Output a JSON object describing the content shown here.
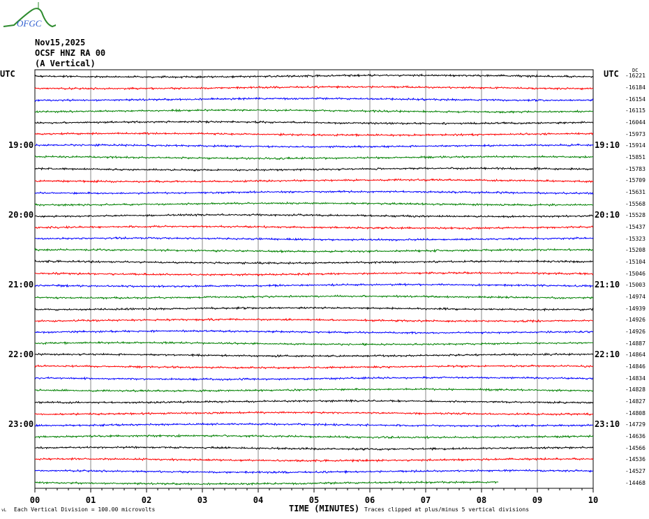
{
  "header": {
    "date": "Nov15,2025",
    "station": "OCSF HNZ RA 00",
    "component": "(A Vertical)",
    "logo_text": "OFGC"
  },
  "chart_data": {
    "type": "line",
    "title": "OCSF HNZ RA 00 (A Vertical) Nov15,2025",
    "xlabel": "TIME (MINUTES)",
    "x_ticks": [
      "00",
      "01",
      "02",
      "03",
      "04",
      "05",
      "06",
      "07",
      "08",
      "09",
      "10"
    ],
    "xlim": [
      0,
      10
    ],
    "left_axis_title": "UTC",
    "right_axis_title": "UTC",
    "dc_header": "DC",
    "left_time_labels": [
      {
        "row": 6,
        "label": "19:00"
      },
      {
        "row": 12,
        "label": "20:00"
      },
      {
        "row": 18,
        "label": "21:00"
      },
      {
        "row": 24,
        "label": "22:00"
      },
      {
        "row": 30,
        "label": "23:00"
      }
    ],
    "right_time_labels": [
      {
        "row": 6,
        "label": "19:10"
      },
      {
        "row": 12,
        "label": "20:10"
      },
      {
        "row": 18,
        "label": "21:10"
      },
      {
        "row": 24,
        "label": "22:10"
      },
      {
        "row": 30,
        "label": "23:10"
      }
    ],
    "trace_colors": [
      "#000000",
      "#ff0000",
      "#0000ff",
      "#008000"
    ],
    "dc_offsets": [
      "-16221",
      "-16184",
      "-16154",
      "-16115",
      "-16044",
      "-15973",
      "-15914",
      "-15851",
      "-15783",
      "-15709",
      "-15631",
      "-15568",
      "-15528",
      "-15437",
      "-15323",
      "-15208",
      "-15104",
      "-15046",
      "-15003",
      "-14974",
      "-14939",
      "-14926",
      "-14926",
      "-14887",
      "-14864",
      "-14846",
      "-14834",
      "-14828",
      "-14827",
      "-14808",
      "-14729",
      "-14636",
      "-14566",
      "-14536",
      "-14527",
      "-14468"
    ],
    "last_trace_end_minutes": 8.3
  },
  "footer": {
    "scale": "Each Vertical Division =  100.00 microvolts",
    "clip": "Traces clipped at plus/minus 5 vertical divisions",
    "corner": "vL"
  }
}
